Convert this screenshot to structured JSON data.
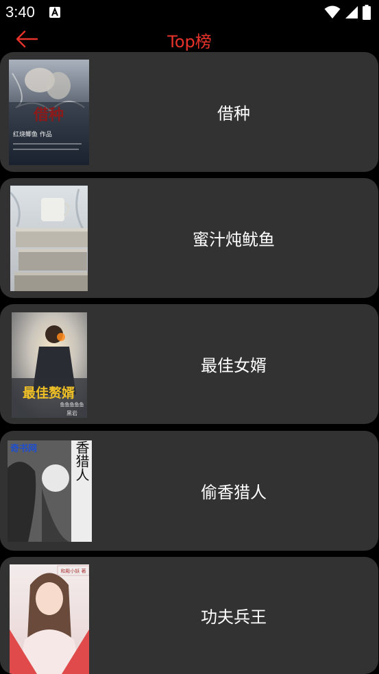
{
  "status_bar": {
    "time": "3:40"
  },
  "app_bar": {
    "title": "Top榜",
    "accent_color": "#e8332b"
  },
  "books": [
    {
      "title": "借种",
      "cover_text": "借种",
      "cover_author": "红烧鲫鱼 作品"
    },
    {
      "title": "蜜汁炖鱿鱼"
    },
    {
      "title": "最佳女婿",
      "cover_text": "最佳赘婿",
      "cover_author": "鱼鱼鱼鱼鱼",
      "cover_badge": "黑岩"
    },
    {
      "title": "偷香猎人",
      "cover_text": "偷香猎人",
      "cover_site": "奇书网"
    },
    {
      "title": "功夫兵王",
      "cover_tag": "和殿小妖 著"
    }
  ],
  "colors": {
    "background": "#000000",
    "card": "#323232",
    "text": "#ffffff"
  },
  "icons": [
    "back-arrow-icon",
    "wifi-icon",
    "signal-icon",
    "battery-icon",
    "notification-icon"
  ]
}
